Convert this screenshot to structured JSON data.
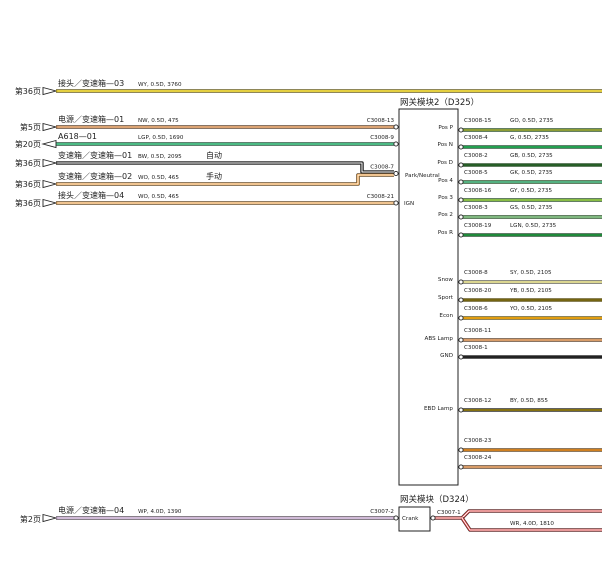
{
  "module_d325": {
    "title": "网关模块2（D325）",
    "inputs": [
      {
        "page": "第36页",
        "source": "接头／变速箱—03",
        "spec": "WY, 0.5D, 3760",
        "color": "#d4b800",
        "stripe": "#f4e680"
      },
      {
        "page": "第5页",
        "source": "电源／变速箱—01",
        "spec": "NW, 0.5D, 475",
        "color": "#c07030",
        "stripe": "#f7d8b8",
        "connector": "C3008-13",
        "pin": "Pos P"
      },
      {
        "page": "第20页",
        "source": "A618—01",
        "spec": "LGP, 0.5D, 1690",
        "color": "#1aa060",
        "stripe": "#7fd6a8",
        "connector": "C3008-9",
        "pin": "Pos N"
      },
      {
        "page": "第36页",
        "source": "变速箱／变速箱—01",
        "spec": "BW, 0.5D, 2095",
        "color": "#222222",
        "stripe": "#ffffff",
        "note": "自动",
        "connector": "C3008-7",
        "pin": "Park/Neutral"
      },
      {
        "page": "第36页",
        "source": "变速箱／变速箱—02",
        "spec": "WO, 0.5D, 465",
        "color": "#e08a20",
        "stripe": "#ffffff",
        "note": "手动"
      },
      {
        "page": "第36页",
        "source": "接头／变速箱—04",
        "spec": "WO, 0.5D, 465",
        "color": "#e08a20",
        "stripe": "#ffffff",
        "connector": "C3008-21",
        "pin": "IGN"
      }
    ],
    "outputs": [
      {
        "pin": "Pos P",
        "connector": "C3008-15",
        "spec": "GO, 0.5D, 2735",
        "color": "#2a9a2a",
        "stripe": "#f0a040"
      },
      {
        "pin": "Pos N",
        "connector": "C3008-4",
        "spec": "G, 0.5D, 2735",
        "color": "#23a050",
        "stripe": "#23a050"
      },
      {
        "pin": "Pos D",
        "connector": "C3008-2",
        "spec": "GB, 0.5D, 2735",
        "color": "#2a9a2a",
        "stripe": "#222222"
      },
      {
        "pin": "Pos 4",
        "connector": "C3008-5",
        "spec": "GK, 0.5D, 2735",
        "color": "#2a9a2a",
        "stripe": "#7ec8d8"
      },
      {
        "pin": "Pos 3",
        "connector": "C3008-16",
        "spec": "GY, 0.5D, 2735",
        "color": "#2a9a2a",
        "stripe": "#e8e060"
      },
      {
        "pin": "Pos 2",
        "connector": "C3008-3",
        "spec": "GS, 0.5D, 2735",
        "color": "#2a9a2a",
        "stripe": "#d8d8d8"
      },
      {
        "pin": "Pos R",
        "connector": "C3008-19",
        "spec": "LGN, 0.5D, 2735",
        "color": "#1f8a3a",
        "stripe": "#1f8a3a"
      },
      {
        "pin": "Snow",
        "connector": "C3008-8",
        "spec": "SY, 0.5D, 2105",
        "color": "#c9c9a8",
        "stripe": "#ede27a"
      },
      {
        "pin": "Sport",
        "connector": "C3008-20",
        "spec": "YB, 0.5D, 2105",
        "color": "#c8a800",
        "stripe": "#222222"
      },
      {
        "pin": "Econ",
        "connector": "C3008-6",
        "spec": "YO, 0.5D, 2105",
        "color": "#d4b000",
        "stripe": "#f08a20"
      },
      {
        "pin": "ABS Lamp",
        "connector": "C3008-11",
        "spec": "",
        "color": "#c07030",
        "stripe": "#f0c8a0"
      },
      {
        "pin": "GND",
        "connector": "C3008-1",
        "spec": "",
        "color": "#222222",
        "stripe": "#222222"
      },
      {
        "pin": "EBD Lamp",
        "connector": "C3008-12",
        "spec": "BY, 0.5D, 855",
        "color": "#222222",
        "stripe": "#e8c000"
      },
      {
        "pin": "",
        "connector": "C3008-23",
        "spec": "",
        "color": "#d08020",
        "stripe": "#d08020"
      },
      {
        "pin": "",
        "connector": "C3008-24",
        "spec": "",
        "color": "#c07030",
        "stripe": "#f0c8a0"
      }
    ]
  },
  "module_d324": {
    "title": "网关模块（D324）",
    "input": {
      "page": "第2页",
      "source": "电源／变速箱—04",
      "spec": "WP, 4.0D, 1390",
      "color": "#b99ac0",
      "stripe": "#e9dcef",
      "connector": "C3007-2",
      "pin": "Crank"
    },
    "output": {
      "connector": "C3007-1",
      "spec": "WR, 4.0D, 1810",
      "color": "#d03030",
      "stripe": "#ffffff"
    }
  }
}
